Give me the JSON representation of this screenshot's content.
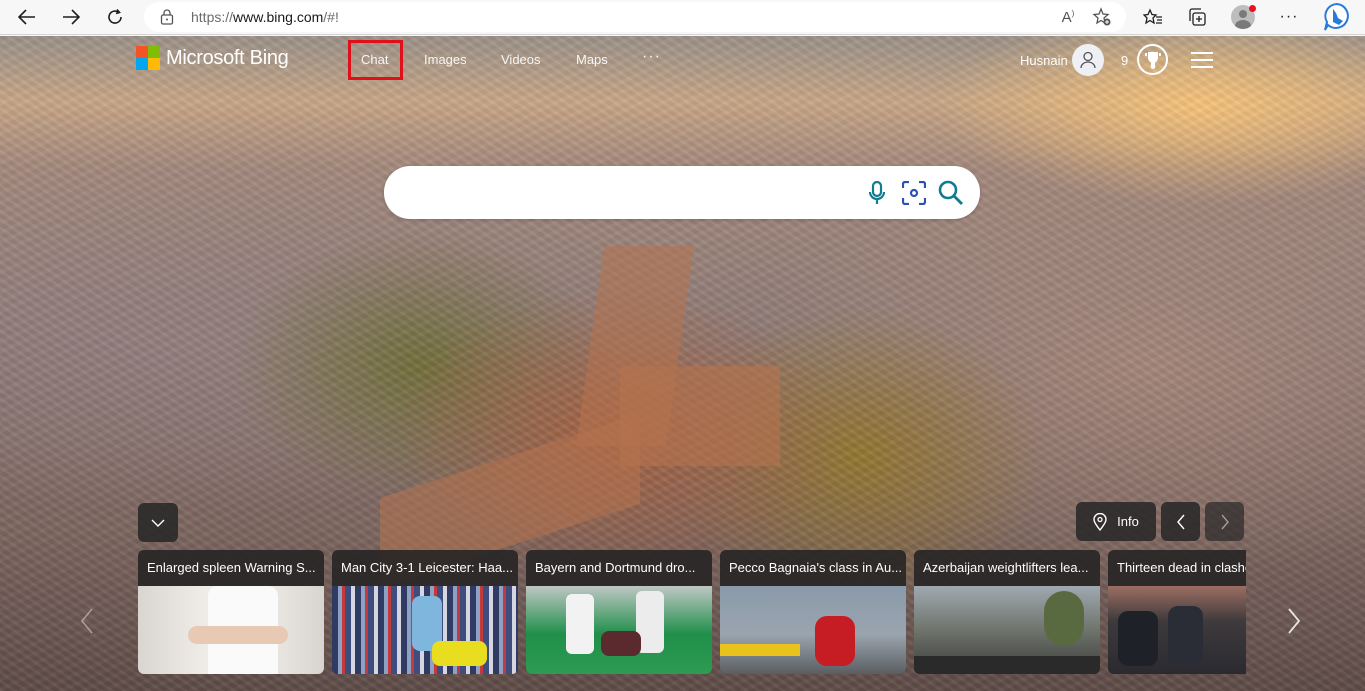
{
  "browser": {
    "url_prefix": "https://",
    "url_domain": "www.bing.com",
    "url_suffix": "/#!",
    "icons": [
      "back-icon",
      "forward-icon",
      "refresh-icon",
      "lock-icon",
      "read-aloud-icon",
      "add-favorite-icon",
      "favorites-icon",
      "collections-icon",
      "profile-icon",
      "more-icon",
      "bing-copilot-icon"
    ]
  },
  "header": {
    "logo_text": "Microsoft Bing",
    "logo_colors": [
      "#f35325",
      "#81bc06",
      "#05a6f0",
      "#ffba08"
    ],
    "nav": [
      {
        "label": "Chat",
        "highlighted": true
      },
      {
        "label": "Images"
      },
      {
        "label": "Videos"
      },
      {
        "label": "Maps"
      },
      {
        "label": "···"
      }
    ],
    "user_name": "Husnain",
    "rewards_points": "9",
    "highlight_color": "#e0101a"
  },
  "search": {
    "value": "",
    "placeholder": "",
    "icons": [
      "microphone-icon",
      "visual-search-icon",
      "search-icon"
    ],
    "icon_color": "#0f7c90"
  },
  "image_controls": {
    "info_label": "Info"
  },
  "news": [
    {
      "title": "Enlarged spleen Warning S..."
    },
    {
      "title": "Man City 3-1 Leicester: Haa..."
    },
    {
      "title": "Bayern and Dortmund dro..."
    },
    {
      "title": "Pecco Bagnaia's class in Au..."
    },
    {
      "title": "Azerbaijan weightlifters lea..."
    },
    {
      "title": "Thirteen dead in clashes"
    }
  ]
}
